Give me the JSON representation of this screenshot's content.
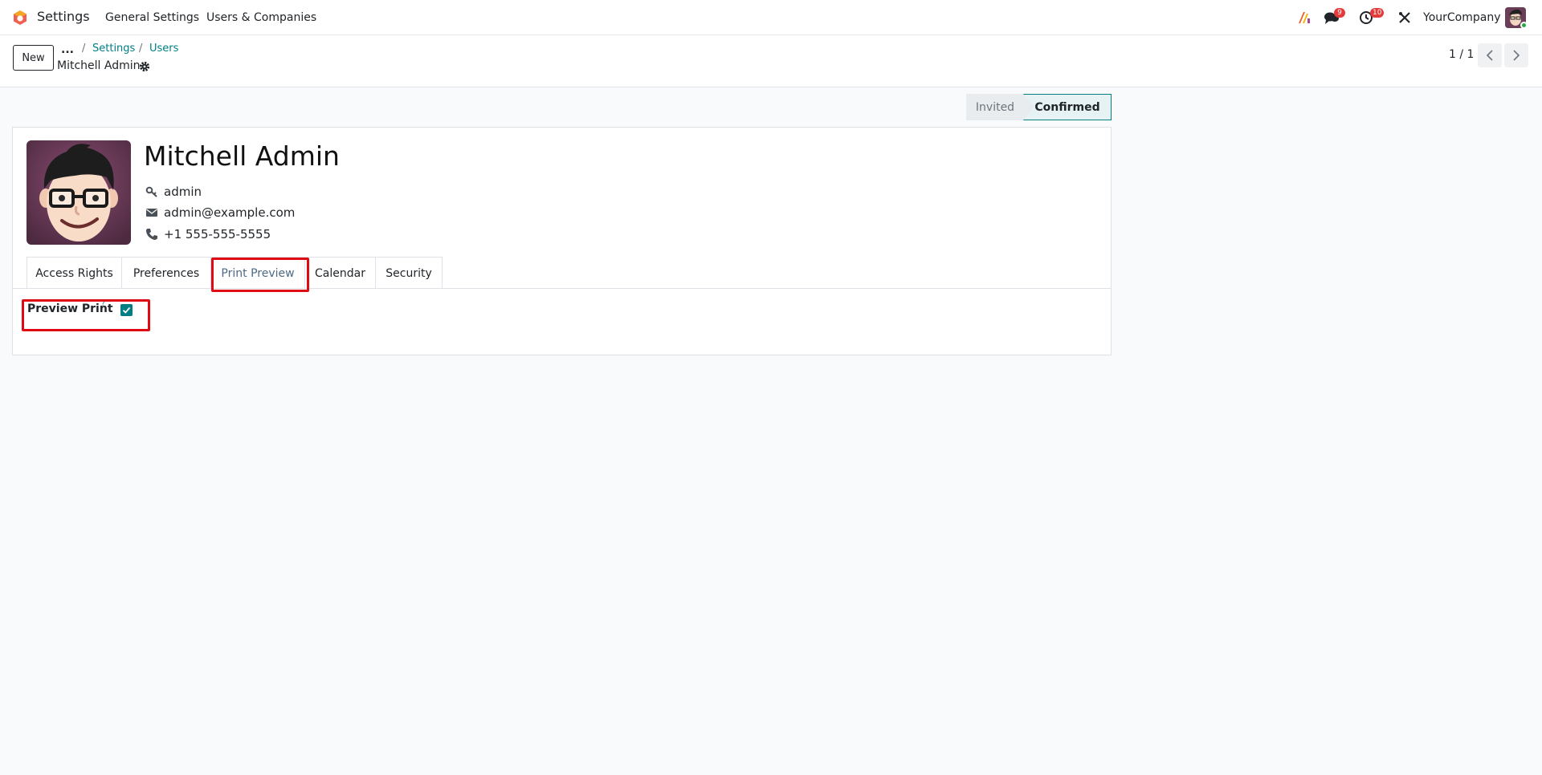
{
  "navbar": {
    "app_name": "Settings",
    "menu": [
      "General Settings",
      "Users & Companies"
    ],
    "messages_badge": "9",
    "activities_badge": "10",
    "company": "YourCompany"
  },
  "control": {
    "new_label": "New",
    "breadcrumb_more": "...",
    "breadcrumb": [
      "Settings",
      "Users"
    ],
    "record_title": "Mitchell Admin",
    "pager": "1 / 1"
  },
  "status": {
    "stages": [
      "Invited",
      "Confirmed"
    ],
    "current": "Confirmed"
  },
  "user": {
    "name": "Mitchell Admin",
    "login": "admin",
    "email": "admin@example.com",
    "phone": "+1 555-555-5555"
  },
  "tabs": [
    "Access Rights",
    "Preferences",
    "Print Preview",
    "Calendar",
    "Security"
  ],
  "active_tab": "Print Preview",
  "print_preview": {
    "label": "Preview Print",
    "help_mark": "?",
    "checked": true
  },
  "colors": {
    "accent": "#017e84",
    "highlight": "#e00a14",
    "badge": "#e43a3a"
  }
}
